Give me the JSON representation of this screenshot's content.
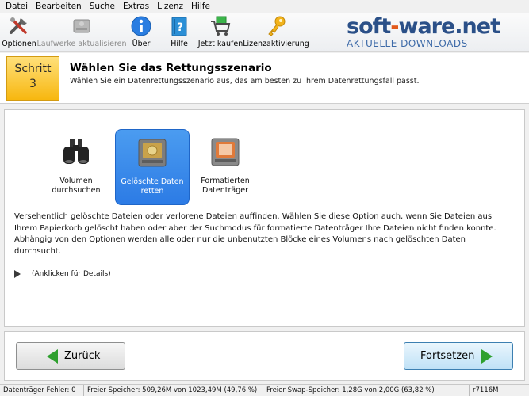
{
  "menu": {
    "items": [
      "Datei",
      "Bearbeiten",
      "Suche",
      "Extras",
      "Lizenz",
      "Hilfe"
    ]
  },
  "toolbar": {
    "buttons": [
      {
        "label": "Optionen",
        "icon": "tools-icon",
        "enabled": true
      },
      {
        "label": "Laufwerke aktualisieren",
        "icon": "drive-refresh-icon",
        "enabled": false
      },
      {
        "label": "Über",
        "icon": "info-icon",
        "enabled": true
      },
      {
        "label": "Hilfe",
        "icon": "help-book-icon",
        "enabled": true
      },
      {
        "label": "Jetzt kaufen",
        "icon": "shopping-cart-icon",
        "enabled": true
      },
      {
        "label": "Lizenzaktivierung",
        "icon": "key-icon",
        "enabled": true
      }
    ]
  },
  "brand": {
    "name_part1": "soft",
    "name_dash": "-",
    "name_part2": "ware.net",
    "tagline": "AKTUELLE DOWNLOADS"
  },
  "step": {
    "label": "Schritt",
    "number": "3",
    "title": "Wählen Sie das Rettungsszenario",
    "description": "Wählen Sie ein Datenrettungsszenario aus, das am besten zu Ihrem Datenrettungsfall passt."
  },
  "options": [
    {
      "line1": "Volumen",
      "line2": "durchsuchen",
      "icon": "binoculars-icon",
      "selected": false
    },
    {
      "line1": "Gelöschte Daten",
      "line2": "retten",
      "icon": "deleted-files-drive-icon",
      "selected": true
    },
    {
      "line1": "Formatierten",
      "line2": "Datenträger",
      "icon": "formatted-drive-icon",
      "selected": false
    }
  ],
  "option_description": "Versehentlich gelöschte Dateien oder verlorene Dateien auffinden. Wählen Sie diese Option auch, wenn Sie Dateien aus Ihrem Papierkorb gelöscht haben oder aber der Suchmodus für formatierte Datenträger Ihre Dateien nicht finden konnte. Abhängig von den Optionen werden alle oder nur die unbenutzten Blöcke eines Volumens nach gelöschten Daten durchsucht.",
  "details_link": "(Anklicken für Details)",
  "nav": {
    "back_label": "Zurück",
    "next_label": "Fortsetzen"
  },
  "status": {
    "errors": "Datenträger Fehler: 0",
    "free_memory": "Freier Speicher: 509,26M von 1023,49M (49,76 %)",
    "free_swap": "Freier Swap-Speicher: 1,28G von 2,00G (63,82 %)",
    "version": "r7116M"
  },
  "colors": {
    "step_badge": "#f7b70f",
    "selection": "#2c7be5",
    "brand_blue": "#2b5088",
    "brand_orange": "#e25a1c",
    "arrow_green": "#2ea02e"
  }
}
